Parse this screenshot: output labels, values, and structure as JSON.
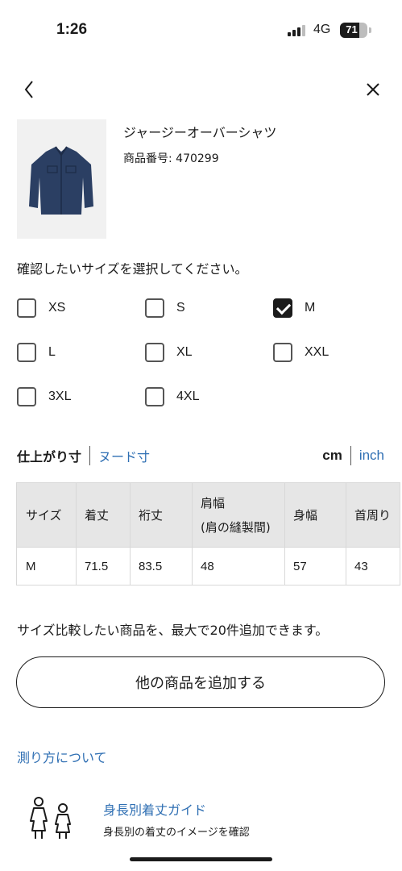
{
  "status_bar": {
    "time": "1:26",
    "network": "4G",
    "battery_percent": "71",
    "battery_level": 0.71,
    "signal_bars_active": 3
  },
  "nav": {
    "back_icon": "chevron-left-icon",
    "close_icon": "close-icon"
  },
  "product": {
    "name": "ジャージーオーバーシャツ",
    "code_label": "商品番号: 470299",
    "image_color": "#2b3f63"
  },
  "size_selection": {
    "prompt": "確認したいサイズを選択してください。",
    "options": [
      {
        "label": "XS",
        "checked": false
      },
      {
        "label": "S",
        "checked": false
      },
      {
        "label": "M",
        "checked": true
      },
      {
        "label": "L",
        "checked": false
      },
      {
        "label": "XL",
        "checked": false
      },
      {
        "label": "XXL",
        "checked": false
      },
      {
        "label": "3XL",
        "checked": false
      },
      {
        "label": "4XL",
        "checked": false
      }
    ]
  },
  "measurement": {
    "active_tab": "仕上がり寸",
    "inactive_tab": "ヌード寸",
    "unit_active": "cm",
    "unit_inactive": "inch"
  },
  "size_table": {
    "headers": [
      "サイズ",
      "着丈",
      "裄丈",
      "肩幅",
      "身幅",
      "首周り"
    ],
    "shoulder_note": "(肩の縫製間)",
    "rows": [
      [
        "M",
        "71.5",
        "83.5",
        "48",
        "57",
        "43"
      ]
    ]
  },
  "compare": {
    "note": "サイズ比較したい商品を、最大で20件追加できます。",
    "add_button": "他の商品を追加する"
  },
  "howto": {
    "link": "測り方について"
  },
  "guide": {
    "title": "身長別着丈ガイド",
    "subtitle": "身長別の着丈のイメージを確認"
  },
  "colors": {
    "link_blue": "#2f6fb3",
    "text": "#1b1b1b",
    "table_header_bg": "#e6e6e6"
  }
}
